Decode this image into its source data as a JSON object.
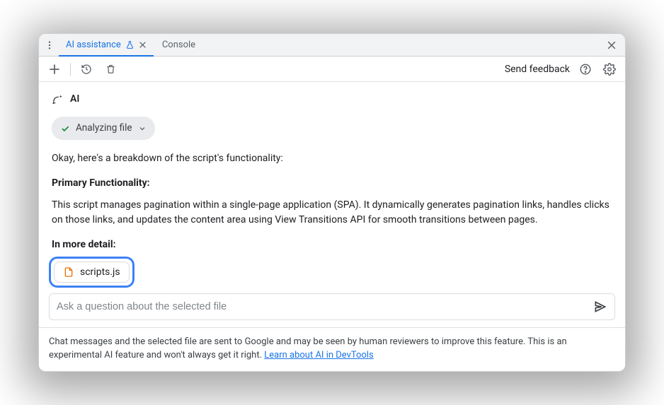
{
  "tabs": {
    "active_label": "AI assistance",
    "console_label": "Console"
  },
  "toolbar": {
    "feedback_label": "Send feedback"
  },
  "ai": {
    "header_label": "AI",
    "status_chip": "Analyzing file",
    "intro": "Okay, here's a breakdown of the script's functionality:",
    "section1_title": "Primary Functionality:",
    "section1_body": "This script manages pagination within a single-page application (SPA). It dynamically generates pagination links, handles clicks on those links, and updates the content area using View Transitions API for smooth transitions between pages.",
    "section2_title": "In more detail:"
  },
  "file": {
    "name": "scripts.js"
  },
  "input": {
    "placeholder": "Ask a question about the selected file"
  },
  "footer": {
    "text_before": "Chat messages and the selected file are sent to Google and may be seen by human reviewers to improve this feature. This is an experimental AI feature and won't always get it right. ",
    "link_text": "Learn about AI in DevTools"
  }
}
